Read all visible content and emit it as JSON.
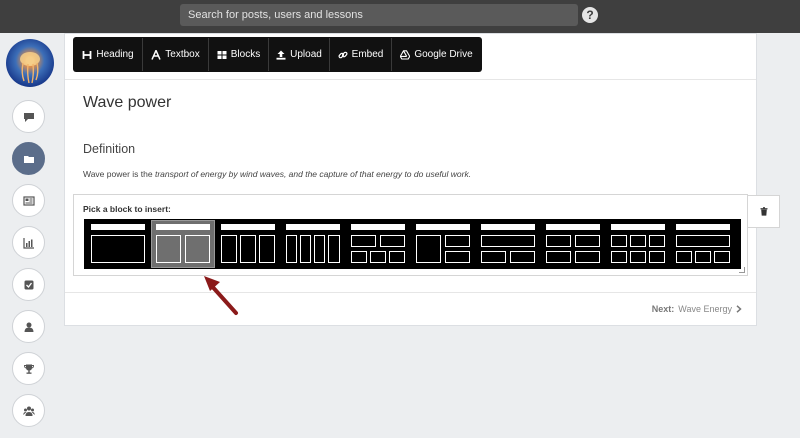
{
  "topbar": {
    "search_placeholder": "Search for posts, users and lessons",
    "help_icon": "question-circle-icon"
  },
  "sidebar": {
    "items": [
      {
        "name": "comments",
        "icon": "comment-icon"
      },
      {
        "name": "folder",
        "icon": "folder-icon",
        "active": true
      },
      {
        "name": "newspaper",
        "icon": "newspaper-icon"
      },
      {
        "name": "stats",
        "icon": "bar-chart-icon"
      },
      {
        "name": "tasks",
        "icon": "checkbox-icon"
      },
      {
        "name": "profile",
        "icon": "user-icon"
      },
      {
        "name": "trophy",
        "icon": "trophy-icon"
      },
      {
        "name": "groups",
        "icon": "users-icon"
      }
    ]
  },
  "toolbar": {
    "heading": "Heading",
    "textbox": "Textbox",
    "blocks": "Blocks",
    "upload": "Upload",
    "embed": "Embed",
    "gdrive": "Google Drive"
  },
  "content": {
    "title": "Wave power",
    "subheading": "Definition",
    "definition_pre": "Wave power is the ",
    "definition_em": "transport of energy by wind waves, and the capture of that energy to do useful work."
  },
  "picker": {
    "label": "Pick a block to insert:",
    "selected_index": 1
  },
  "footer": {
    "next_label": "Next:",
    "next_target": "Wave Energy"
  },
  "colors": {
    "topbar": "#3f3f3f",
    "active_nav": "#5b6d8a",
    "annotation_arrow": "#8b1a1a"
  }
}
